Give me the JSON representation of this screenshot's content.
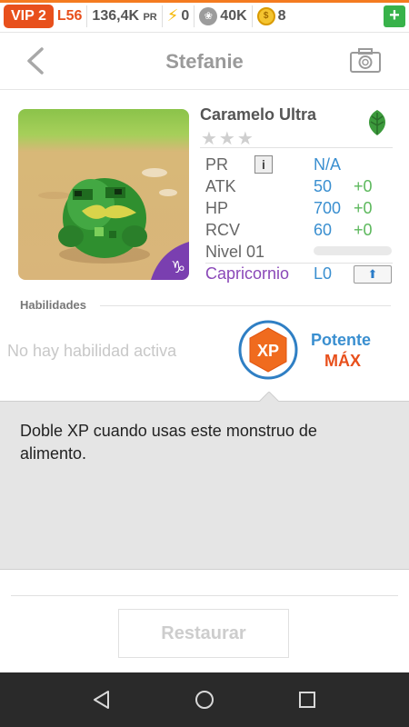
{
  "status_bar": {
    "vip": "VIP 2",
    "level": "L56",
    "pr_value": "136,4K",
    "pr_unit": "PR",
    "energy": "0",
    "food": "40K",
    "coins": "8",
    "coin_glyph": "$",
    "paw_glyph": "❀",
    "bolt_glyph": "⚡",
    "plus": "+"
  },
  "header": {
    "title": "Stefanie",
    "back_icon": "chevron-left",
    "camera_icon": "camera"
  },
  "monster": {
    "name": "Caramelo Ultra",
    "stars": "★★★",
    "element_icon": "leaf",
    "stats": {
      "pr_label": "PR",
      "pr_value": "N/A",
      "info_glyph": "i",
      "atk_label": "ATK",
      "atk_value": "50",
      "atk_bonus": "+0",
      "hp_label": "HP",
      "hp_value": "700",
      "hp_bonus": "+0",
      "rcv_label": "RCV",
      "rcv_value": "60",
      "rcv_bonus": "+0",
      "level_label": "Nivel 01",
      "level_progress": 0,
      "sign_label": "Capricornio",
      "sign_level": "L0",
      "upgrade_glyph": "⬆"
    }
  },
  "abilities": {
    "heading": "Habilidades",
    "empty_text": "No hay habilidad activa",
    "xp_badge": "XP",
    "potency_label": "Potente",
    "potency_level": "MÁX",
    "description": "Doble XP cuando usas este monstruo de alimento."
  },
  "actions": {
    "restore_label": "Restaurar"
  },
  "colors": {
    "accent_orange": "#e8501c",
    "stat_blue": "#3a8fd0",
    "bonus_green": "#5cb85c",
    "sign_purple": "#8a48b8"
  }
}
